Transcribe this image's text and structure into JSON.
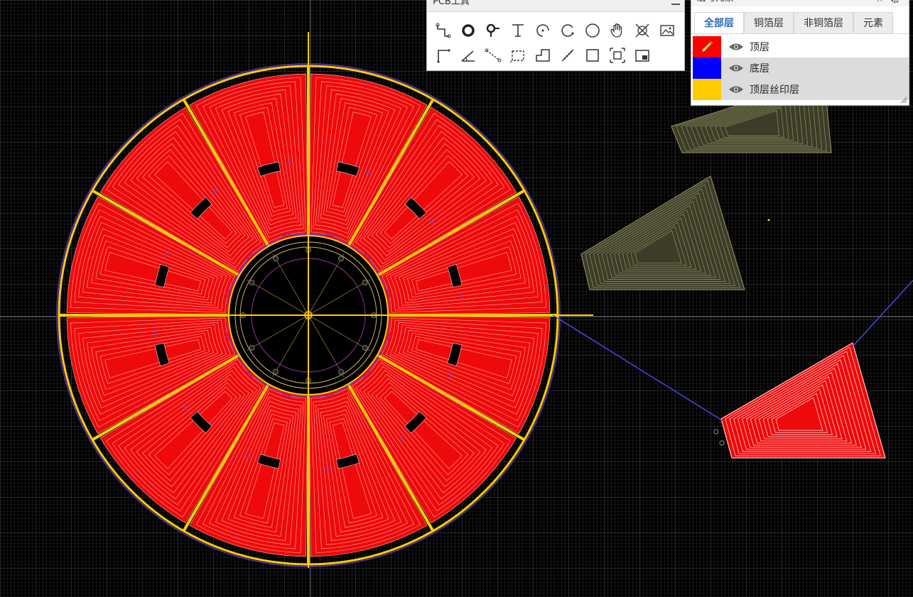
{
  "toolbar": {
    "title": "PCB工具",
    "tools_row1": [
      "route-wire-icon",
      "pad-icon",
      "via-icon",
      "text-icon",
      "arc-center-icon",
      "arc-3point-icon",
      "circle-icon",
      "pan-hand-icon",
      "dimension-icon",
      "image-icon"
    ],
    "tools_row2": [
      "corner-line-icon",
      "angle-icon",
      "dashed-line-icon",
      "rectangle-select-icon",
      "polygon-area-icon",
      "measure-icon",
      "rectangle-icon",
      "group-icon",
      "board-outline-icon"
    ]
  },
  "layers_panel": {
    "title": "层与元素",
    "tabs": [
      {
        "label": "全部层",
        "active": true
      },
      {
        "label": "铜箔层",
        "active": false
      },
      {
        "label": "非铜箔层",
        "active": false
      },
      {
        "label": "元素",
        "active": false
      }
    ],
    "layers": [
      {
        "name": "顶层",
        "color": "#ff0000",
        "active": true
      },
      {
        "name": "底层",
        "color": "#0000ff",
        "active": false
      },
      {
        "name": "顶层丝印层",
        "color": "#ffcc00",
        "active": false
      }
    ]
  },
  "colors": {
    "background": "#000000",
    "grid": "#3a3a3a",
    "top_copper": "#ee0a0a",
    "bottom_copper": "#4a4af0",
    "silkscreen": "#ffcc00",
    "dim_copper": "#4a4a32"
  }
}
